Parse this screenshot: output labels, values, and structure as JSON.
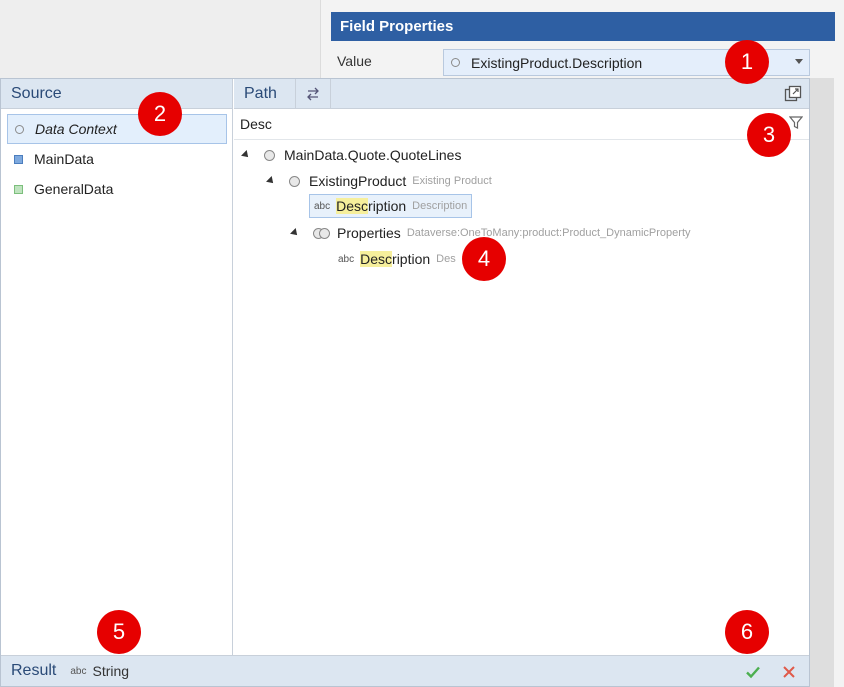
{
  "field_properties": {
    "header": "Field Properties",
    "value_label": "Value",
    "value_selected": "ExistingProduct.Description"
  },
  "source_panel": {
    "title": "Source",
    "items": [
      {
        "label": "Data Context",
        "icon": "ring-icon"
      },
      {
        "label": "MainData",
        "icon": "blue-square-icon"
      },
      {
        "label": "GeneralData",
        "icon": "green-square-icon"
      }
    ]
  },
  "path_panel": {
    "title": "Path",
    "search_value": "Desc",
    "tree": {
      "root": {
        "label": "MainData.Quote.QuoteLines"
      },
      "existing_product": {
        "label": "ExistingProduct",
        "sub": "Existing Product"
      },
      "description_1": {
        "prefix": "abc",
        "highlight": "Desc",
        "rest": "ription",
        "sub": "Description"
      },
      "properties": {
        "label": "Properties",
        "sub": "Dataverse:OneToMany:product:Product_DynamicProperty"
      },
      "description_2": {
        "prefix": "abc",
        "highlight": "Desc",
        "rest": "ription",
        "sub": "Des"
      }
    }
  },
  "result_bar": {
    "label": "Result",
    "type_prefix": "abc",
    "type": "String"
  },
  "markers": [
    "1",
    "2",
    "3",
    "4",
    "5",
    "6"
  ],
  "colors": {
    "header_blue": "#2e5fa3",
    "panel_header": "#dce6f1",
    "highlight": "#f6ef9c",
    "marker_red": "#e60000",
    "ok_green": "#4caf50",
    "cancel_red": "#e05a4a"
  }
}
